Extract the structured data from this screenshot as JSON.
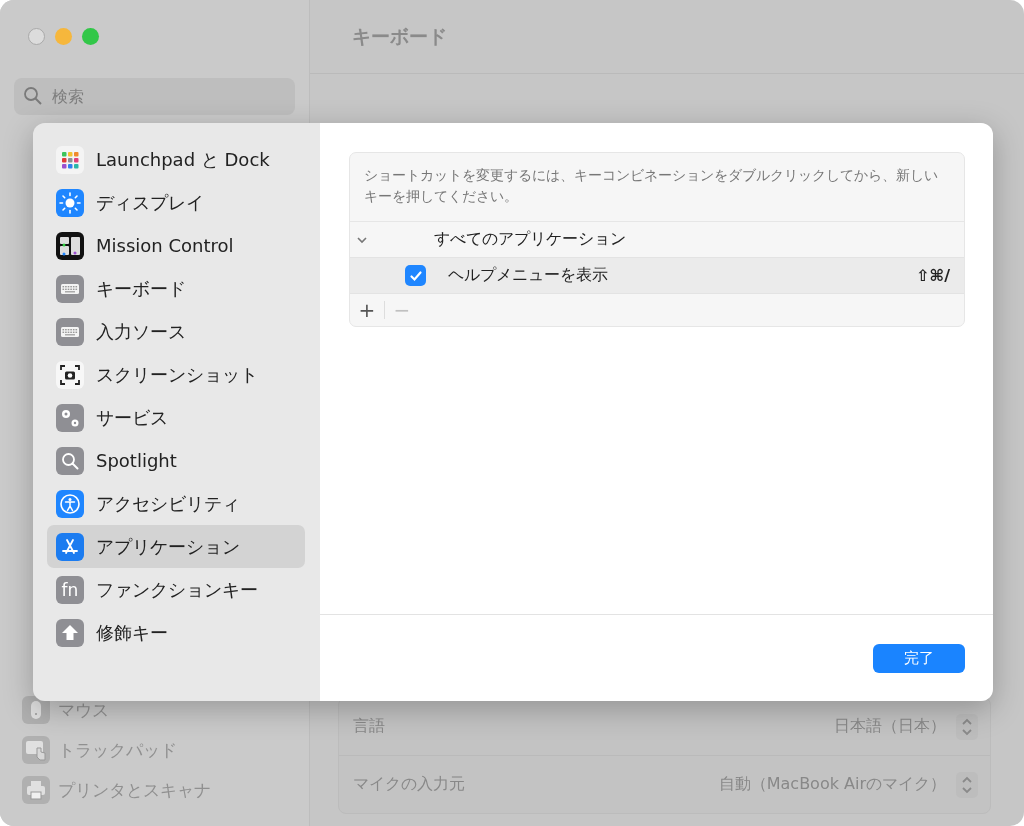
{
  "window": {
    "title": "キーボード"
  },
  "search": {
    "placeholder": "検索"
  },
  "background_sidebar": {
    "items": [
      {
        "label": "マウス",
        "kind": "mouse"
      },
      {
        "label": "トラックパッド",
        "kind": "trackpad"
      },
      {
        "label": "プリンタとスキャナ",
        "kind": "printer"
      }
    ]
  },
  "background_settings": {
    "rows": [
      {
        "label": "言語",
        "value": "日本語（日本）"
      },
      {
        "label": "マイクの入力元",
        "value": "自動（MacBook Airのマイク）"
      }
    ]
  },
  "sheet": {
    "categories": [
      {
        "label": "Launchpad と Dock",
        "kind": "launchpad",
        "selected": false
      },
      {
        "label": "ディスプレイ",
        "kind": "display",
        "selected": false
      },
      {
        "label": "Mission Control",
        "kind": "mission",
        "selected": false
      },
      {
        "label": "キーボード",
        "kind": "keyboard",
        "selected": false
      },
      {
        "label": "入力ソース",
        "kind": "keyboard",
        "selected": false
      },
      {
        "label": "スクリーンショット",
        "kind": "screenshot",
        "selected": false
      },
      {
        "label": "サービス",
        "kind": "services",
        "selected": false
      },
      {
        "label": "Spotlight",
        "kind": "spotlight",
        "selected": false
      },
      {
        "label": "アクセシビリティ",
        "kind": "accessibility",
        "selected": false
      },
      {
        "label": "アプリケーション",
        "kind": "appstore",
        "selected": true
      },
      {
        "label": "ファンクションキー",
        "kind": "fn",
        "icon_text": "fn",
        "selected": false
      },
      {
        "label": "修飾キー",
        "kind": "modifier",
        "selected": false
      }
    ],
    "shortcuts": {
      "description": "ショートカットを変更するには、キーコンビネーションをダブルクリックしてから、新しいキーを押してください。",
      "groups": [
        {
          "label": "すべてのアプリケーション",
          "expanded": true,
          "children": [
            {
              "label": "ヘルプメニューを表示",
              "checked": true,
              "shortcut": "⇧⌘/"
            }
          ]
        }
      ],
      "toolbar": [
        {
          "label": "+",
          "disabled": false
        },
        {
          "label": "−",
          "disabled": true
        }
      ]
    },
    "done_button": "完了"
  }
}
